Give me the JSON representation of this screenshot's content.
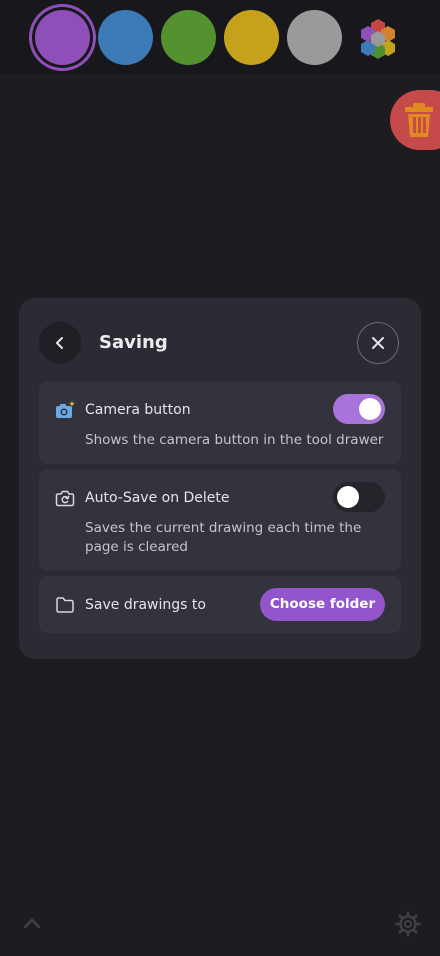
{
  "toolbar": {
    "swatches": [
      {
        "name": "purple",
        "color": "#8e50b8",
        "selected": true
      },
      {
        "name": "blue",
        "color": "#3d7ab8"
      },
      {
        "name": "green",
        "color": "#53922f"
      },
      {
        "name": "yellow",
        "color": "#c6a21c"
      },
      {
        "name": "gray",
        "color": "#9a9a9a"
      }
    ],
    "more_colors_icon": "multicolor-hexagon-icon"
  },
  "trash": {
    "icon": "trash-icon",
    "color": "#c74a4a"
  },
  "panel": {
    "title": "Saving",
    "back_icon": "chevron-left-icon",
    "close_icon": "close-icon",
    "settings": [
      {
        "icon": "camera-sparkle-icon",
        "label": "Camera button",
        "description": "Shows the camera button in the tool drawer",
        "enabled": true
      },
      {
        "icon": "camera-rotate-icon",
        "label": "Auto-Save on Delete",
        "description": "Saves the current drawing each time the page is cleared",
        "enabled": false
      }
    ],
    "save_location": {
      "icon": "folder-icon",
      "label": "Save drawings to",
      "button_label": "Choose folder"
    }
  },
  "footer": {
    "expand_icon": "chevron-up-icon",
    "settings_icon": "gear-icon"
  },
  "colors": {
    "accent": "#9255cc",
    "toggle_on": "#a874da",
    "panel_bg": "#2a2b33",
    "card_bg": "#32333c"
  }
}
